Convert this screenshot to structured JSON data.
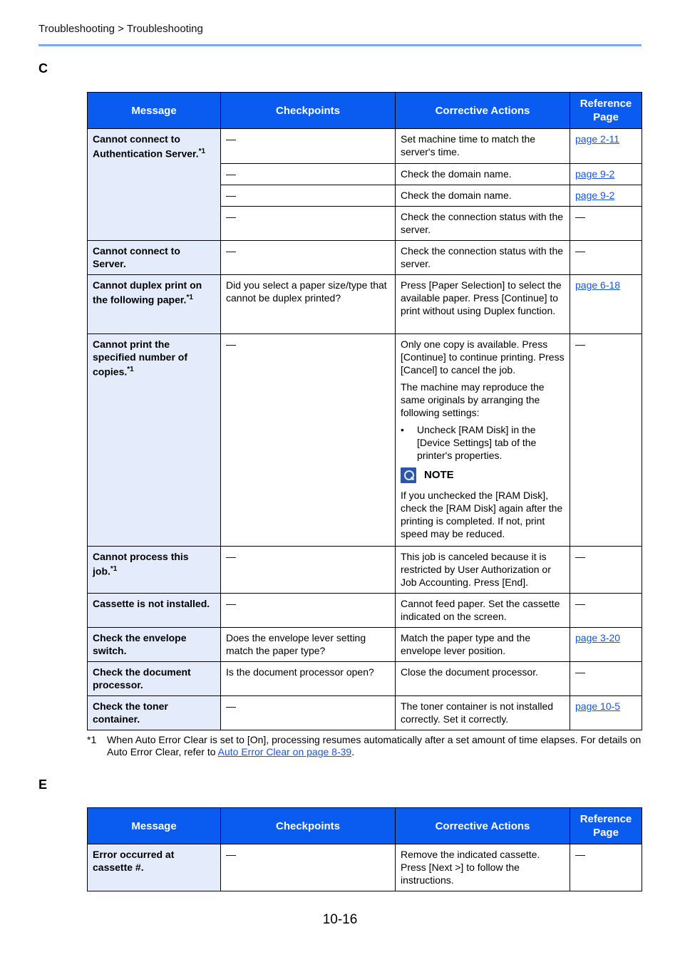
{
  "header": {
    "breadcrumb": "Troubleshooting > Troubleshooting"
  },
  "columns": {
    "message": "Message",
    "checkpoints": "Checkpoints",
    "corrective": "Corrective Actions",
    "reference": "Reference Page"
  },
  "section_c": {
    "letter": "C",
    "rows": [
      {
        "message": "Cannot connect to Authentication Server.",
        "sup": "*1",
        "sub": [
          {
            "checkpoint": "—",
            "action": "Set machine time to match the server's time.",
            "ref": "page 2-11",
            "ref_is_link": true
          },
          {
            "checkpoint": "—",
            "action": "Check the domain name.",
            "ref": "page 9-2",
            "ref_is_link": true
          },
          {
            "checkpoint": "—",
            "action": "Check the domain name.",
            "ref": "page 9-2",
            "ref_is_link": true
          },
          {
            "checkpoint": "—",
            "action": "Check the connection status with the server.",
            "ref": "—",
            "ref_is_link": false
          }
        ]
      },
      {
        "message": "Cannot connect to Server.",
        "sup": "",
        "checkpoint": "—",
        "action": "Check the connection status with the server.",
        "ref": "—",
        "ref_is_link": false
      },
      {
        "message": "Cannot duplex print on the following paper.",
        "sup": "*1",
        "checkpoint": "Did you select a paper size/type that cannot be duplex printed?",
        "action": "Press [Paper Selection] to select the available paper. Press [Continue] to print without using Duplex function.",
        "ref": "page 6-18",
        "ref_is_link": true
      },
      {
        "message": "Cannot print the specified number of copies.",
        "sup": "*1",
        "checkpoint": "—",
        "action_para1": "Only one copy is available. Press [Continue] to continue printing. Press [Cancel] to cancel the job.",
        "action_para2": "The machine may reproduce the same originals by arranging the following settings:",
        "bullet_symbol": "•",
        "bullet": "Uncheck [RAM Disk] in the [Device Settings] tab of the printer's properties.",
        "note_label": "NOTE",
        "note_icon": "note-lightbulb-icon",
        "note_text": "If you unchecked the [RAM Disk], check the [RAM Disk] again after the printing is completed. If not, print speed may be reduced.",
        "ref": "—",
        "ref_is_link": false
      },
      {
        "message": "Cannot process this job.",
        "sup": "*1",
        "checkpoint": "—",
        "action": "This job is canceled because it is restricted by User Authorization or Job Accounting. Press [End].",
        "ref": "—",
        "ref_is_link": false
      },
      {
        "message": "Cassette is not installed.",
        "sup": "",
        "checkpoint": "—",
        "action": "Cannot feed paper. Set the cassette indicated on the screen.",
        "ref": "—",
        "ref_is_link": false
      },
      {
        "message": "Check the envelope switch.",
        "sup": "",
        "checkpoint": "Does the envelope lever setting match the paper type?",
        "action": "Match the paper type and the envelope lever position.",
        "ref": "page 3-20",
        "ref_is_link": true
      },
      {
        "message": "Check the document processor.",
        "sup": "",
        "checkpoint": "Is the document processor open?",
        "action": "Close the document processor.",
        "ref": "—",
        "ref_is_link": false
      },
      {
        "message": "Check the toner container.",
        "sup": "",
        "checkpoint": "—",
        "action": "The toner container is not installed correctly. Set it correctly.",
        "ref": "page 10-5",
        "ref_is_link": true
      }
    ]
  },
  "footnote": {
    "mark": "*1",
    "text": "When Auto Error Clear is set to [On], processing resumes automatically after a set amount of time elapses. For details on Auto Error Clear, refer to ",
    "link": "Auto Error Clear on page 8-39",
    "end": "."
  },
  "section_e": {
    "letter": "E",
    "rows": [
      {
        "message": "Error occurred at cassette #.",
        "checkpoint": "—",
        "action": "Remove the indicated cassette. Press [Next >] to follow the instructions.",
        "ref": "—"
      }
    ]
  },
  "page_number": "10-16",
  "colors": {
    "header_bg": "#0a5cf0",
    "message_bg": "#e4ebfa",
    "link": "#1a56d6",
    "rule": "#7fa8f0"
  }
}
